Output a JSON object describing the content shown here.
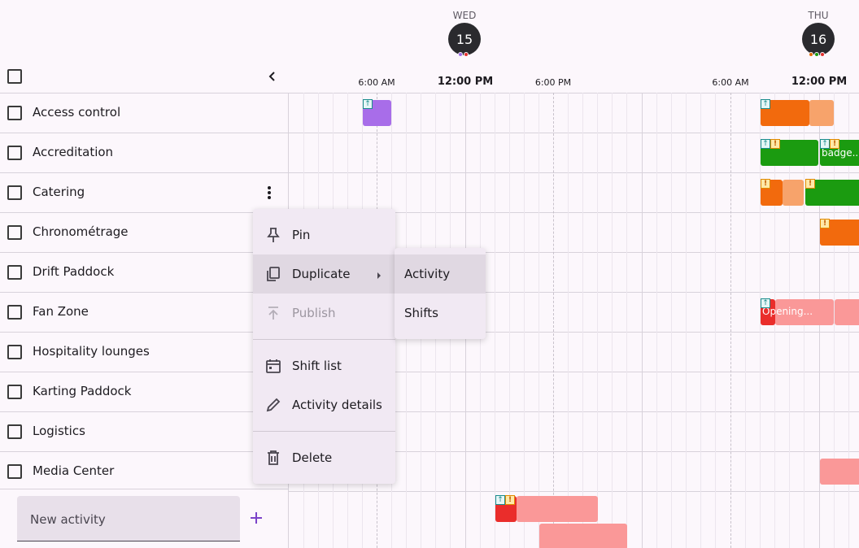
{
  "header": {
    "days": [
      {
        "name": "WED",
        "date": "15",
        "dots": [
          "#9b6ce6",
          "#e2302d"
        ]
      },
      {
        "name": "THU",
        "date": "16",
        "dots": [
          "#e36a00",
          "#1a9c0c",
          "#e2302d"
        ]
      }
    ],
    "times": [
      "6:00 AM",
      "12:00 PM",
      "6:00 PM",
      "6:00 AM",
      "12:00 PM"
    ],
    "collapse_icon": "chevron-left-icon"
  },
  "rows": [
    {
      "label": "Access control"
    },
    {
      "label": "Accreditation"
    },
    {
      "label": "Catering"
    },
    {
      "label": "Chronométrage"
    },
    {
      "label": "Drift Paddock"
    },
    {
      "label": "Fan Zone"
    },
    {
      "label": "Hospitality lounges"
    },
    {
      "label": "Karting Paddock"
    },
    {
      "label": "Logistics"
    },
    {
      "label": "Media Center"
    }
  ],
  "bars": {
    "accreditation_label": "badge...",
    "fanzone_label": "Opening..."
  },
  "colors": {
    "purple": "#a86de9",
    "orange": "#f26a0d",
    "orange_light": "#f7a36b",
    "green": "#1b9b10",
    "red": "#ea2d2b",
    "pink": "#fa9898"
  },
  "context_menu": {
    "items": [
      {
        "label": "Pin",
        "icon": "pin-icon"
      },
      {
        "label": "Duplicate",
        "icon": "copy-icon"
      },
      {
        "label": "Publish",
        "icon": "upload-icon"
      },
      {
        "label": "Shift list",
        "icon": "calendar-icon"
      },
      {
        "label": "Activity details",
        "icon": "pencil-icon"
      },
      {
        "label": "Delete",
        "icon": "trash-icon"
      }
    ]
  },
  "submenu": {
    "items": [
      {
        "label": "Activity"
      },
      {
        "label": "Shifts"
      }
    ]
  },
  "new_activity": {
    "placeholder": "New activity"
  }
}
